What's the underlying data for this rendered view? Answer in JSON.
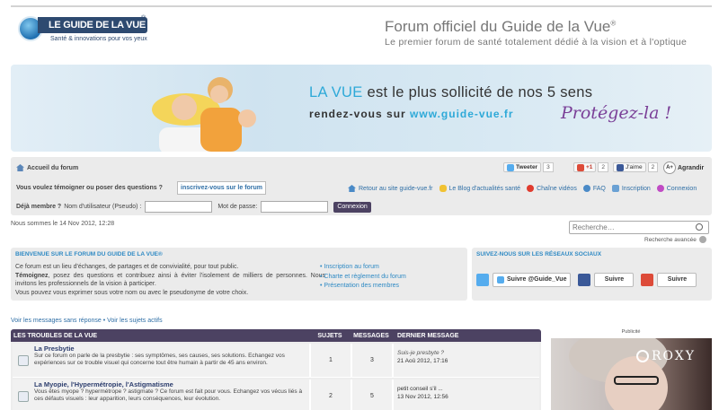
{
  "header": {
    "logo_name": "LE GUIDE DE LA VUE",
    "logo_reg": "®",
    "logo_tagline": "Santé & innovations pour vos yeux",
    "title": "Forum officiel du Guide de la Vue",
    "title_reg": "®",
    "subtitle": "Le premier forum de santé totalement dédié à la vision et à l'optique"
  },
  "banner": {
    "line1_accent": "LA VUE",
    "line1_rest": " est le plus sollicité de nos 5 sens",
    "line2_prefix": "rendez-vous sur ",
    "line2_url": "www.guide-vue.fr",
    "slogan": "Protégez-la !"
  },
  "nav": {
    "home": "Accueil du forum",
    "tweet_label": "Tweeter",
    "tweet_count": "3",
    "gplus_label": "+1",
    "gplus_count": "2",
    "fb_label": "J'aime",
    "fb_count": "2",
    "enlarge_icon": "A+",
    "enlarge_label": "Agrandir",
    "question": "Vous voulez témoigner ou poser des questions ?",
    "register_button": "inscrivez-vous sur le forum",
    "links": [
      {
        "label": "Retour au site guide-vue.fr",
        "icon": "home-icon"
      },
      {
        "label": "Le Blog d'actualités santé",
        "icon": "chat-icon"
      },
      {
        "label": "Chaîne vidéos",
        "icon": "play-icon"
      },
      {
        "label": "FAQ",
        "icon": "help-icon"
      },
      {
        "label": "Inscription",
        "icon": "register-icon"
      },
      {
        "label": "Connexion",
        "icon": "power-icon"
      }
    ],
    "member_label": "Déjà membre ?",
    "username_label": "Nom d'utilisateur (Pseudo) :",
    "password_label": "Mot de passe:",
    "login_button": "Connexion"
  },
  "date_text": "Nous sommes le 14 Nov 2012, 12:28",
  "search": {
    "placeholder": "Recherche…",
    "advanced": "Recherche avancée"
  },
  "welcome": {
    "title": "BIENVENUE SUR LE FORUM DU GUIDE DE LA VUE®",
    "text_p1": "Ce forum est un lieu d'échanges, de partages et de convivialité, pour tout public.",
    "text_strong": "Témoignez",
    "text_p2": ", posez des questions et contribuez ainsi à éviter l'isolement de milliers de personnes. Nous invitons les professionnels de la vision à participer.",
    "text_p3": "Vous pouvez vous exprimer sous votre nom ou avec le pseudonyme de votre choix.",
    "links": [
      "Inscription au forum",
      "Charte et règlement du forum",
      "Présentation des membres"
    ]
  },
  "social": {
    "title": "SUIVEZ-NOUS SUR LES RÉSEAUX SOCIAUX",
    "twitter_follow": "Suivre @Guide_Vue",
    "fb_follow": "Suivre",
    "gplus_follow": "Suivre"
  },
  "links_row": {
    "unanswered": "Voir les messages sans réponse",
    "separator": " • ",
    "active": "Voir les sujets actifs"
  },
  "forum": {
    "category": "LES TROUBLES DE LA VUE",
    "col_topics": "SUJETS",
    "col_messages": "MESSAGES",
    "col_last": "DERNIER MESSAGE",
    "rows": [
      {
        "title": "La Presbytie",
        "desc": "Sur ce forum on parle de la presbytie : ses symptômes, ses causes, ses solutions. Echangez vos expériences sur ce trouble visuel qui concerne tout être humain à partir de 45 ans environ.",
        "topics": "1",
        "messages": "3",
        "last_title": "Suis-je presbyte ?",
        "last_date": "21 Aoû 2012, 17:16"
      },
      {
        "title": "La Myopie, l'Hypermétropie, l'Astigmatisme",
        "desc": "Vous êtes myope ? hypermétrope ? astigmate ? Ce forum est fait pour vous. Echangez vos vécus liés à ces défauts visuels : leur apparition, leurs conséquences, leur évolution.",
        "topics": "2",
        "messages": "5",
        "last_title": "petit conseil s'il ...",
        "last_date": "13 Nov 2012, 12:56"
      }
    ]
  },
  "ad": {
    "label": "Publicité",
    "brand": "ROXY"
  },
  "colors": {
    "accent": "#2ea9d8",
    "forum_header": "#4c4262",
    "slogan": "#7a3f97",
    "logo": "#2e4a70"
  }
}
